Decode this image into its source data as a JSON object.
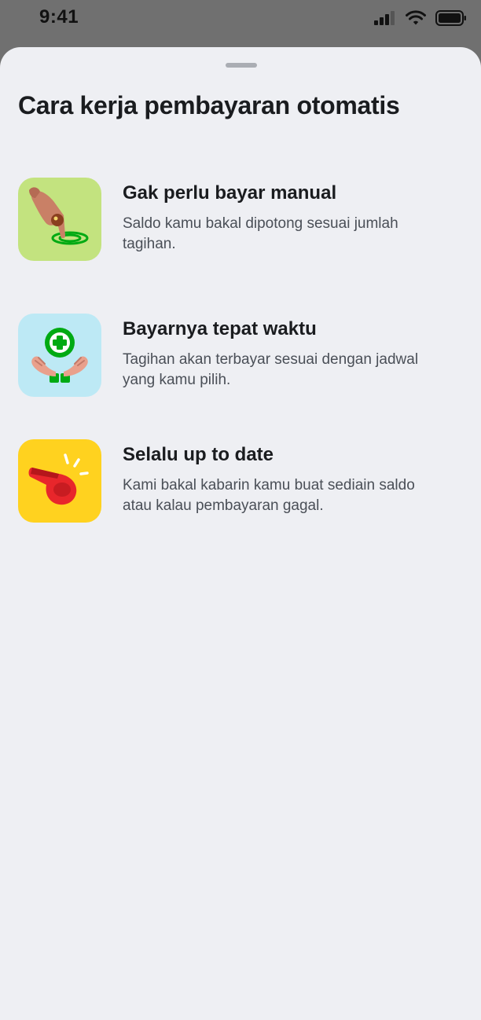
{
  "status_bar": {
    "time": "9:41",
    "icons": [
      "signal-icon",
      "wifi-icon",
      "battery-icon"
    ]
  },
  "sheet": {
    "title": "Cara kerja pembayaran otomatis",
    "features": [
      {
        "icon": "hand-tap-icon",
        "icon_bg": "#C3E37F",
        "title": "Gak perlu bayar manual",
        "description": "Saldo kamu bakal dipotong sesuai jumlah tagihan."
      },
      {
        "icon": "hands-plus-icon",
        "icon_bg": "#BDE9F5",
        "title": "Bayarnya tepat waktu",
        "description": "Tagihan akan terbayar sesuai dengan jadwal yang kamu pilih."
      },
      {
        "icon": "whistle-icon",
        "icon_bg": "#FFD21F",
        "title": "Selalu up to date",
        "description": "Kami bakal kabarin kamu buat sediain saldo atau kalau pembayaran gagal."
      }
    ]
  },
  "colors": {
    "sheet_background": "#EEEFF3",
    "overlay": "#707070",
    "title_text": "#1A1C1F",
    "body_text": "#4A4F57",
    "accent_green": "#00AA13"
  }
}
